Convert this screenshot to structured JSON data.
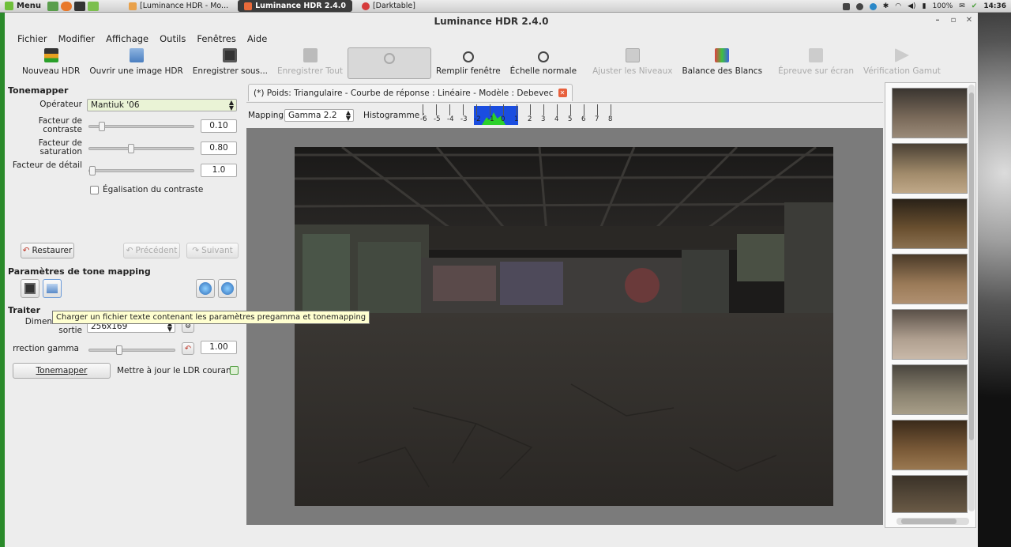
{
  "taskbar": {
    "menu_label": "Menu",
    "tasks": [
      {
        "label": "[Luminance HDR - Mo...",
        "active": false
      },
      {
        "label": "Luminance HDR 2.4.0",
        "active": true
      },
      {
        "label": "[Darktable]",
        "active": false
      }
    ],
    "battery": "100%",
    "clock": "14:36"
  },
  "window": {
    "title": "Luminance HDR 2.4.0",
    "controls": [
      "–",
      "▫",
      "✕"
    ]
  },
  "menubar": [
    "Fichier",
    "Modifier",
    "Affichage",
    "Outils",
    "Fenêtres",
    "Aide"
  ],
  "toolbar": [
    {
      "label": "Nouveau HDR",
      "disabled": false
    },
    {
      "label": "Ouvrir une image HDR",
      "disabled": false
    },
    {
      "label": "Enregistrer sous...",
      "disabled": false
    },
    {
      "label": "Enregistrer Tout",
      "disabled": true
    },
    {
      "label": "",
      "disabled": false,
      "pressed": true
    },
    {
      "label": "Remplir fenêtre",
      "disabled": false
    },
    {
      "label": "Échelle normale",
      "disabled": false
    },
    {
      "label": "Ajuster les Niveaux",
      "disabled": true
    },
    {
      "label": "Balance des Blancs",
      "disabled": false
    },
    {
      "label": "Épreuve sur écran",
      "disabled": true
    },
    {
      "label": "Vérification Gamut",
      "disabled": true
    }
  ],
  "tonemapper": {
    "section_title": "Tonemapper",
    "operator_label": "Opérateur",
    "operator_value": "Mantiuk '06",
    "contrast_label": "Facteur de contraste",
    "contrast_value": "0.10",
    "contrast_level": 0.1,
    "saturation_label": "Facteur de saturation",
    "saturation_value": "0.80",
    "saturation_level": 0.4,
    "detail_label": "Facteur de détail",
    "detail_value": "1.0",
    "detail_level": 0.0,
    "equalization_label": "Égalisation du contraste",
    "equalization_checked": false,
    "restore_label": "Restaurer",
    "previous_label": "Précédent",
    "next_label": "Suivant"
  },
  "params": {
    "section_title": "Paramètres de tone mapping",
    "tooltip": "Charger un fichier texte contenant les paramètres pregamma et tonemapping"
  },
  "process": {
    "section_title": "Traiter",
    "output_label": "Dimension de sortie",
    "output_value": "256x169",
    "gamma_label": "rrection gamma",
    "gamma_value": "1.00",
    "gamma_level": 0.35,
    "tonemap_button": "Tonemapper",
    "update_label": "Mettre à jour le LDR courant"
  },
  "viewer": {
    "tab_title": "(*) Poids: Triangulaire - Courbe de réponse : Linéaire - Modèle : Debevec",
    "mapping_label": "Mapping:",
    "mapping_value": "Gamma 2.2",
    "histogram_label": "Histogramme :",
    "histogram_ticks": [
      "-6",
      "-5",
      "-4",
      "-3",
      "-2",
      "-1",
      "0",
      "1",
      "2",
      "3",
      "4",
      "5",
      "6",
      "7",
      "8"
    ]
  },
  "colors": {
    "accent_green": "#2a8a2a",
    "tooltip_bg": "#ffffd0",
    "histogram_blue": "#1a4de0",
    "histogram_green": "#2bd12b"
  }
}
